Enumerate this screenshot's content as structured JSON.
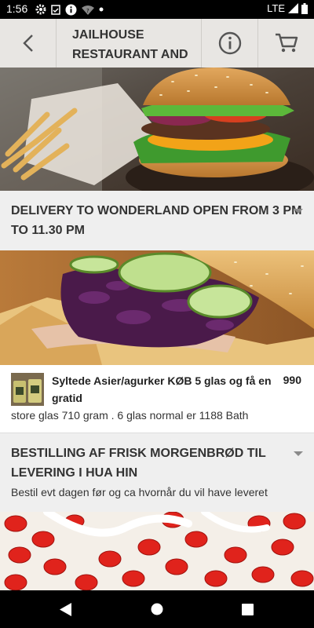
{
  "status_bar": {
    "time": "1:56",
    "network": "LTE"
  },
  "header": {
    "title_line1": "JAILHOUSE",
    "title_line2": "RESTAURANT AND"
  },
  "section1": {
    "title_line1": "DELIVERY TO WONDERLAND OPEN FROM 3 PM",
    "title_line2": "TO 11.30 PM"
  },
  "item": {
    "name_line1": "Syltede Asier/agurker KØB 5 glas og få en",
    "name_line2": "gratid",
    "price": "990",
    "description": "store glas 710 gram . 6 glas normal er 1188 Bath"
  },
  "section2": {
    "title_line1": "BESTILLING AF FRISK MORGENBRØD TIL",
    "title_line2": "LEVERING I HUA HIN",
    "description": "Bestil evt dagen før og ca hvornår du vil have leveret"
  }
}
